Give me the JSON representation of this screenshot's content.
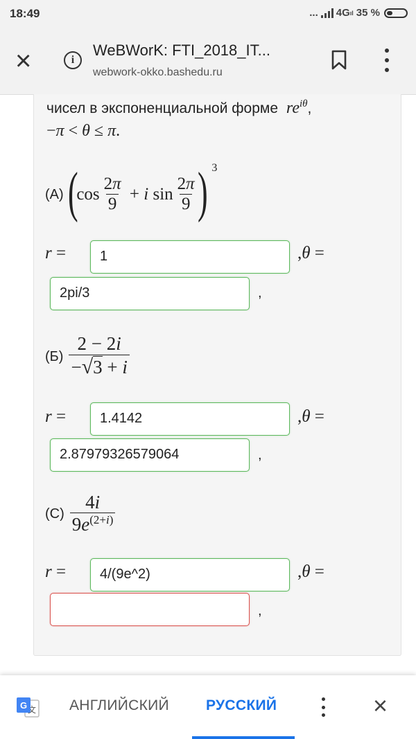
{
  "status": {
    "time": "18:49",
    "dots": "...",
    "network": "4G",
    "network_sub": "ıl",
    "battery": "35 %"
  },
  "browser": {
    "title": "WeBWorK: FTI_2018_IT...",
    "url": "webwork-okko.bashedu.ru"
  },
  "content": {
    "intro_line1": "чисел в экспоненциальной форме",
    "labels": {
      "a": "(A)",
      "b": "(Б)",
      "c": "(C)"
    },
    "answers": [
      {
        "r": "1",
        "theta": "2pi/3",
        "status": "correct"
      },
      {
        "r": "1.4142",
        "theta": "2.87979326579064",
        "status": "correct"
      },
      {
        "r": "4/(9e^2)",
        "theta": "",
        "status": "incorrect"
      }
    ]
  },
  "translate": {
    "lang_from": "АНГЛИЙСКИЙ",
    "lang_to": "РУССКИЙ"
  },
  "colors": {
    "correct_border": "#5cb85c",
    "incorrect_border": "#d9534f",
    "accent": "#1a73e8"
  }
}
